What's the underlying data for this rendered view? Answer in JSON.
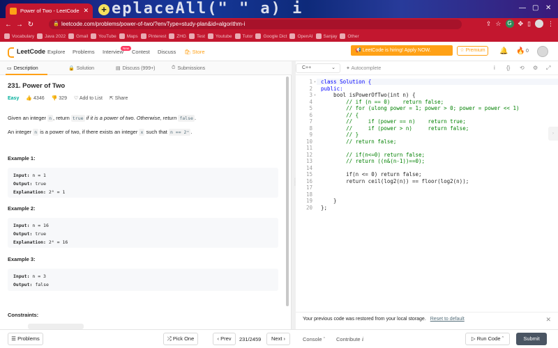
{
  "browser": {
    "tab_title": "Power of Two - LeetCode",
    "url": "leetcode.com/problems/power-of-two/?envType=study-plan&id=algorithm-i",
    "background_text": "eplaceAll(\"  \"  a) i ",
    "bookmarks": [
      "Vocabulary",
      "Java 2022",
      "Gmail",
      "YouTube",
      "Maps",
      "Pinterest",
      "ZHG",
      "Test",
      "Youtube",
      "Tutor",
      "Google Dict",
      "OpenAI",
      "Sanjay",
      "Other"
    ]
  },
  "header": {
    "logo": "LeetCode",
    "nav": [
      "Explore",
      "Problems",
      "Interview",
      "Contest",
      "Discuss",
      "Store"
    ],
    "new_badge": "New",
    "promo": "LeetCode is hiring! Apply NOW.",
    "premium": "Premium",
    "streak": "0"
  },
  "left_tabs": [
    "Description",
    "Solution",
    "Discuss (999+)",
    "Submissions"
  ],
  "problem": {
    "title": "231. Power of Two",
    "difficulty": "Easy",
    "likes": "4346",
    "dislikes": "329",
    "add_to_list": "Add to List",
    "share": "Share",
    "desc1_a": "Given an integer ",
    "desc1_n": "n",
    "desc1_b": ", return ",
    "desc1_true": "true",
    "desc1_c": " if it is a power of two. Otherwise, return ",
    "desc1_false": "false",
    "desc1_d": ".",
    "desc2_a": "An integer ",
    "desc2_n": "n",
    "desc2_b": " is a power of two, if there exists an integer ",
    "desc2_x": "x",
    "desc2_c": " such that ",
    "desc2_eq": "n == 2ˣ",
    "desc2_d": ".",
    "examples": [
      {
        "heading": "Example 1:",
        "input": "n = 1",
        "output": "true",
        "explanation": "2⁰ = 1"
      },
      {
        "heading": "Example 2:",
        "input": "n = 16",
        "output": "true",
        "explanation": "2⁴ = 16"
      },
      {
        "heading": "Example 3:",
        "input": "n = 3",
        "output": "false",
        "explanation": ""
      }
    ],
    "input_label": "Input:",
    "output_label": "Output:",
    "explanation_label": "Explanation:",
    "constraints": "Constraints:"
  },
  "editor": {
    "language": "C++",
    "autocomplete": "Autocomplete",
    "lines": [
      "class Solution {",
      "public:",
      "    bool isPowerOfTwo(int n) {",
      "        // if (n == 0)    return false;",
      "        // for (ulong power = 1; power > 0; power = power << 1)",
      "        // {",
      "        //     if (power == n)    return true;",
      "        //     if (power > n)     return false;",
      "        // }",
      "        // return false;",
      "",
      "        // if(n<=0) return false;",
      "        // return ((n&(n-1))==0);",
      "",
      "        if(n <= 0) return false;",
      "        return ceil(log2(n)) == floor(log2(n));",
      "",
      "",
      "    }",
      "};"
    ],
    "restored_msg": "Your previous code was restored from your local storage.",
    "reset_link": "Reset to default"
  },
  "footer": {
    "problems": "Problems",
    "pick_one": "Pick One",
    "prev": "Prev",
    "pager": "231/2459",
    "next": "Next",
    "console": "Console",
    "contribute": "Contribute",
    "run_code": "Run Code",
    "submit": "Submit"
  }
}
